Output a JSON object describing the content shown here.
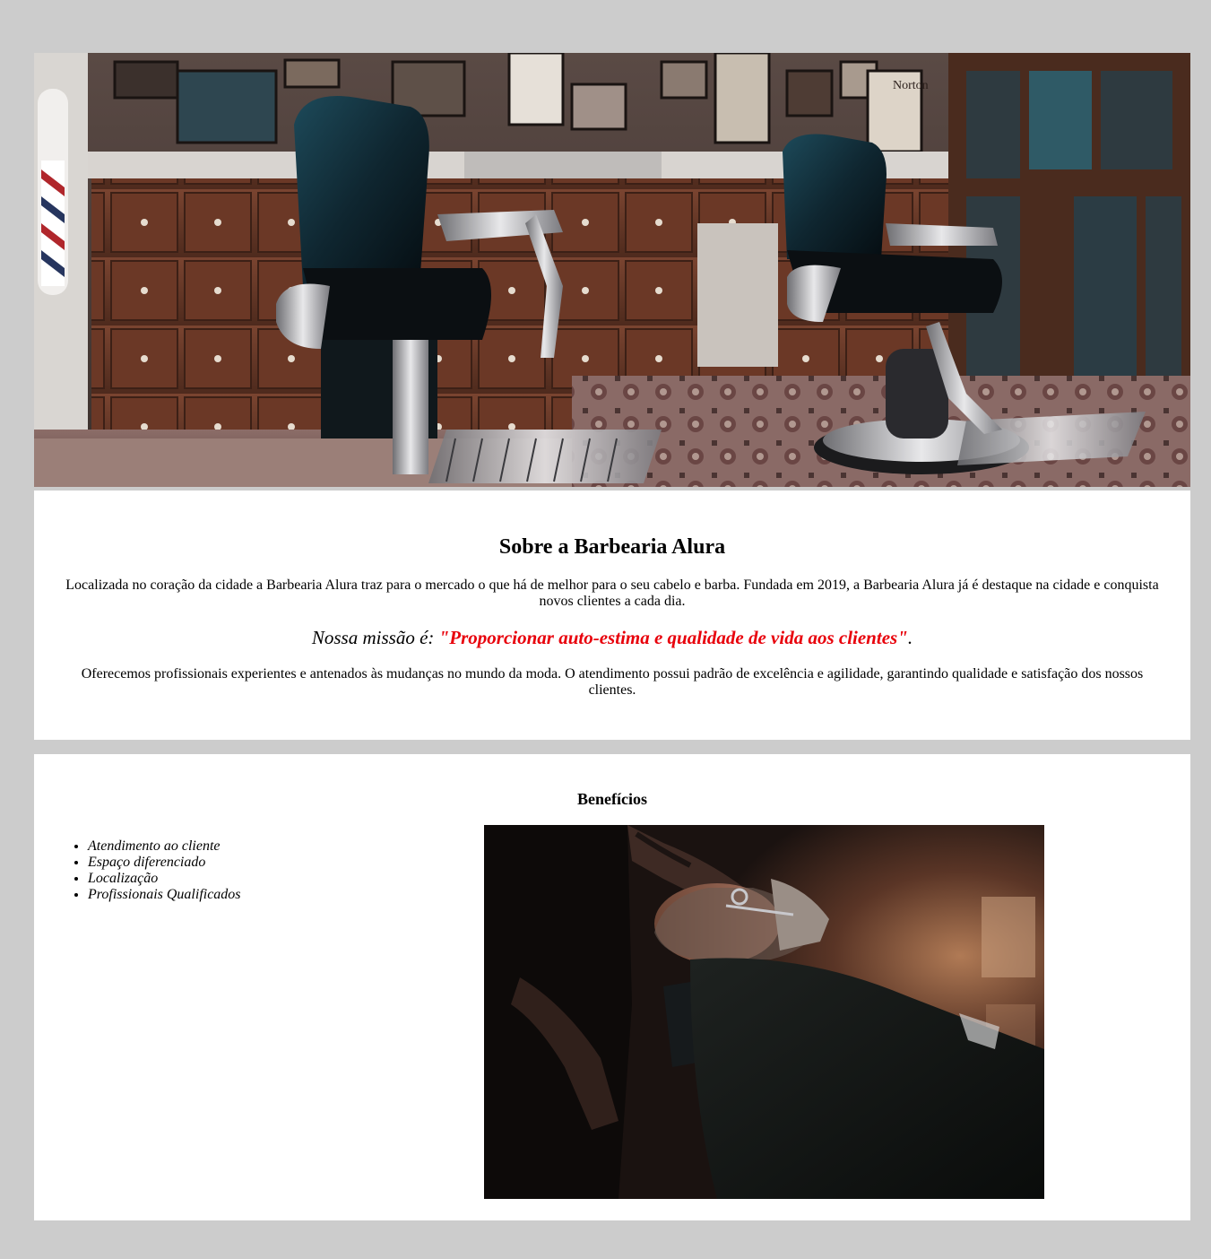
{
  "hero": {
    "image": "barbershop-interior-image",
    "sign_text": "Norton"
  },
  "about": {
    "title": "Sobre a Barbearia Alura",
    "paragraph1": "Localizada no coração da cidade a Barbearia Alura traz para o mercado o que há de melhor para o seu cabelo e barba. Fundada em 2019, a Barbearia Alura já é destaque na cidade e conquista novos clientes a cada dia.",
    "mission_prefix": "Nossa missão é: ",
    "mission_quote": "\"Proporcionar auto-estima e qualidade de vida aos clientes\"",
    "mission_suffix": ".",
    "paragraph2": "Oferecemos profissionais experientes e antenados às mudanças no mundo da moda. O atendimento possui padrão de excelência e agilidade, garantindo qualidade e satisfação dos nossos clientes."
  },
  "benefits": {
    "title": "Benefícios",
    "items": [
      "Atendimento ao cliente",
      "Espaço diferenciado",
      "Localização",
      "Profissionais Qualificados"
    ],
    "image": "beard-trim-image"
  },
  "colors": {
    "background": "#cccccc",
    "panel": "#ffffff",
    "mission_quote": "#e8000b"
  }
}
